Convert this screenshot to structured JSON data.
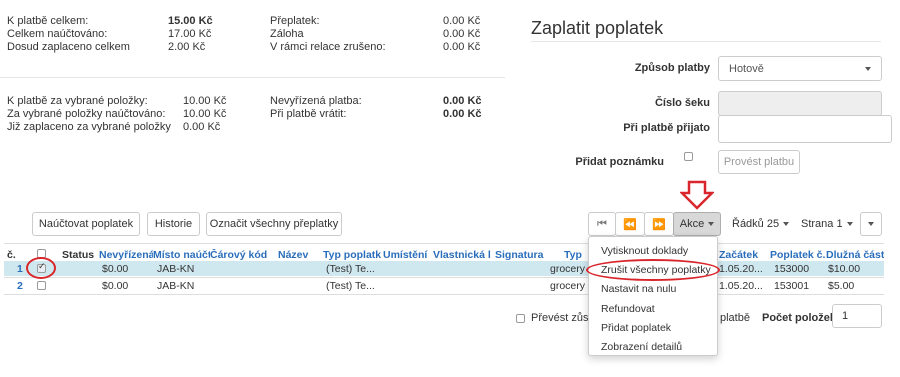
{
  "summary_left": {
    "row1": [
      {
        "label": "K platbě celkem:",
        "value": "15.00 Kč",
        "bold": true
      },
      {
        "label": "Celkem naúčtováno:",
        "value": "17.00 Kč"
      },
      {
        "label": "Dosud zaplaceno celkem",
        "value": "2.00 Kč"
      }
    ],
    "row2": [
      {
        "label": "Přeplatek:",
        "value": "0.00 Kč"
      },
      {
        "label": "Záloha",
        "value": "0.00 Kč"
      },
      {
        "label": "V rámci relace zrušeno:",
        "value": "0.00 Kč"
      }
    ],
    "row3": [
      {
        "label": "K platbě za vybrané položky:",
        "value": "10.00 Kč"
      },
      {
        "label": "Za vybrané položky naúčtováno:",
        "value": "10.00 Kč"
      },
      {
        "label": "Již zaplaceno za vybrané položky",
        "value": "0.00 Kč"
      }
    ],
    "row4": [
      {
        "label": "Nevyřízená platba:",
        "value": "0.00 Kč"
      },
      {
        "label": "Při platbě vrátit:",
        "value": "0.00 Kč"
      }
    ]
  },
  "pay_panel": {
    "title": "Zaplatit poplatek",
    "method_label": "Způsob platby",
    "method_value": "Hotově",
    "check_label": "Číslo šeku",
    "received_label": "Při platbě přijato",
    "note_label": "Přidat poznámku",
    "submit_label": "Provést platbu"
  },
  "toolbar": {
    "charge": "Naúčtovat poplatek",
    "history": "Historie",
    "mark_overpaid": "Označit všechny přeplatky",
    "actions": "Akce",
    "rows": "Řádků 25",
    "page": "Strana 1"
  },
  "table": {
    "headers": [
      "č.",
      "Status",
      "Nevyřízená",
      "Místo naúčt",
      "Čárový kód",
      "Název",
      "Typ poplatk",
      "Umístění",
      "Vlastnická l",
      "Signatura",
      "Typ",
      "Začátek",
      "Poplatek č.",
      "Dlužná část"
    ],
    "rows": [
      {
        "num": "1",
        "pending": "$0.00",
        "place": "JAB-KN",
        "type": "(Test) Te...",
        "kind": "grocery",
        "start": "1.05.20...",
        "fee_no": "153000",
        "due": "$10.00"
      },
      {
        "num": "2",
        "pending": "$0.00",
        "place": "JAB-KN",
        "type": "(Test) Te...",
        "kind": "grocery",
        "start": "1.05.20...",
        "fee_no": "153001",
        "due": "$5.00"
      }
    ]
  },
  "actions_menu": [
    "Vytisknout doklady",
    "Zrušit všechny poplatky",
    "Nastavit na nulu",
    "Refundovat",
    "Přidat poplatek",
    "Zobrazení detailů"
  ],
  "footer": {
    "transfer_partial": "Převést zůst",
    "platbe": "platbě",
    "count_label": "Počet položek",
    "count_value": "1"
  },
  "colors": {
    "link": "#2a6ebb",
    "highlight_row": "#cfe7ef",
    "annotation": "#d9262c"
  }
}
